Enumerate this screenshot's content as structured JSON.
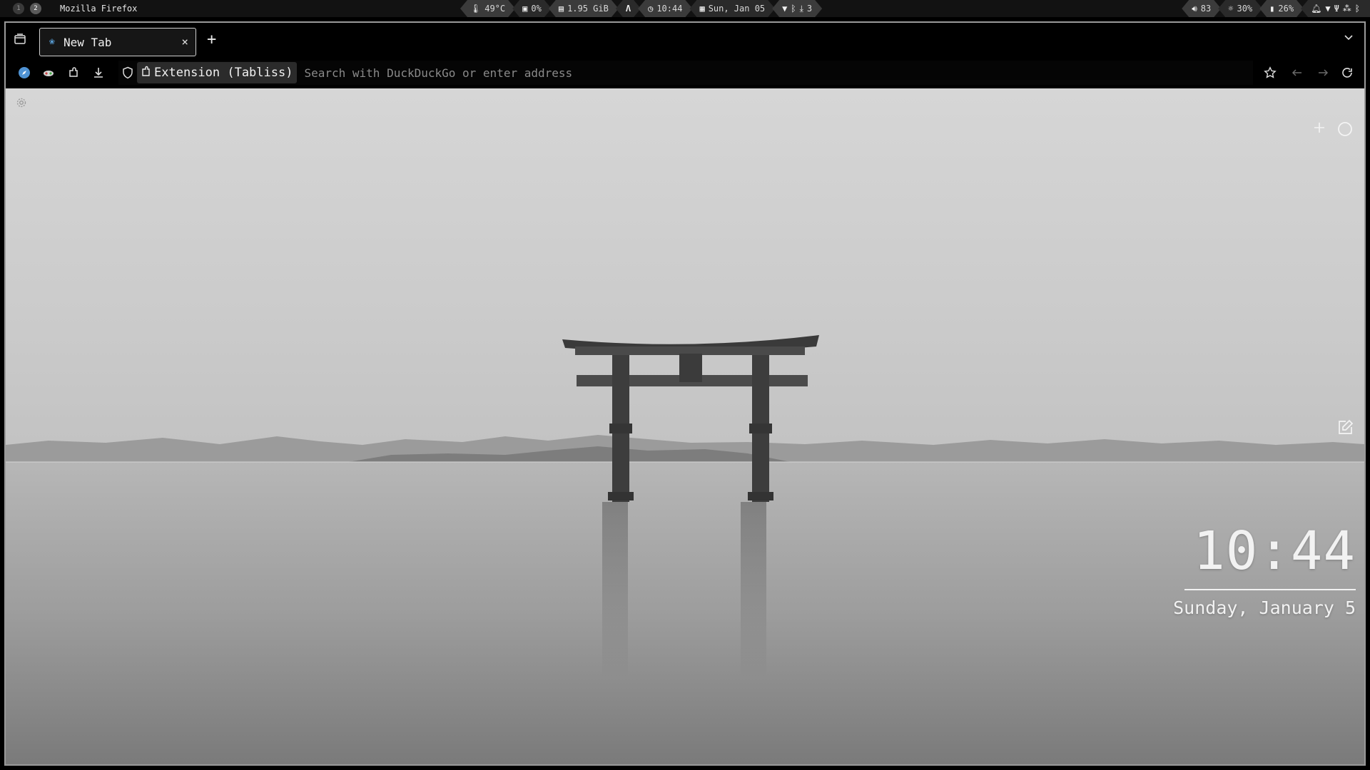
{
  "topbar": {
    "workspaces": [
      "1",
      "2"
    ],
    "window_title": "Mozilla Firefox",
    "modules": {
      "temperature": "49°C",
      "cpu": "0%",
      "memory": "1.95 GiB",
      "time": "10:44",
      "date": "Sun, Jan 05",
      "updates": "3",
      "volume": "83",
      "brightness": "30%",
      "battery": "26%"
    }
  },
  "browser": {
    "tab": {
      "title": "New Tab",
      "close": "×"
    },
    "newtab_label": "+",
    "url": {
      "identity_label": "Extension (Tabliss)",
      "placeholder": "Search with DuckDuckGo or enter address"
    }
  },
  "page": {
    "clock_time": "10:44",
    "clock_date": "Sunday, January 5"
  },
  "icons": {
    "tab_favicon": "tabliss-icon",
    "settings": "gear-icon",
    "add_widget": "plus-icon",
    "circle": "circle-icon",
    "edit": "edit-icon"
  },
  "colors": {
    "bar_bg": "#121212",
    "pill_bg": "#3b3b3b",
    "tab_border": "#cfcfcf",
    "url_chip": "#2b2b2b",
    "sky": "#cfcfcf",
    "water": "#8f8f8f"
  }
}
